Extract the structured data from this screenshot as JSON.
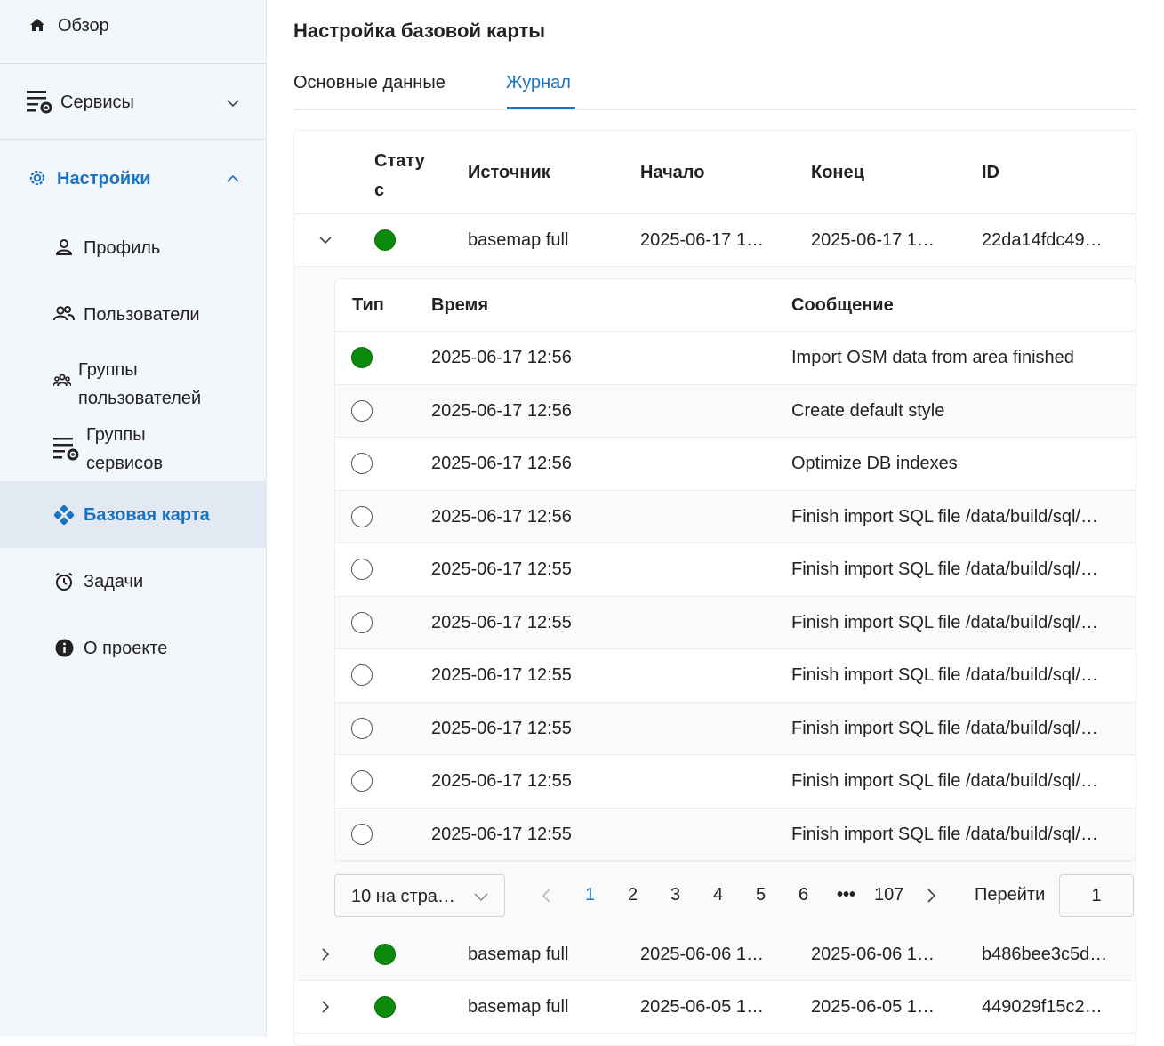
{
  "sidebar": {
    "overview": "Обзор",
    "services": "Сервисы",
    "settings": "Настройки",
    "items": [
      {
        "label": "Профиль"
      },
      {
        "label": "Пользователи"
      },
      {
        "label": "Группы\nпользователей"
      },
      {
        "label": "Группы\nсервисов"
      },
      {
        "label": "Базовая карта"
      },
      {
        "label": "Задачи"
      },
      {
        "label": "О проекте"
      }
    ]
  },
  "page": {
    "title": "Настройка базовой карты",
    "tabs": [
      "Основные данные",
      "Журнал"
    ],
    "active_tab": "Журнал"
  },
  "table": {
    "columns": [
      "Статус",
      "Источник",
      "Начало",
      "Конец",
      "ID"
    ],
    "status_col_line1": "Стату",
    "status_col_line2": "с",
    "rows": [
      {
        "status": "success",
        "source": "basemap full",
        "start": "2025-06-17 1…",
        "end": "2025-06-17 1…",
        "id": "22da14fdc49…",
        "expanded": true
      },
      {
        "status": "success",
        "source": "basemap full",
        "start": "2025-06-06 1…",
        "end": "2025-06-06 1…",
        "id": "b486bee3c5d…",
        "expanded": false
      },
      {
        "status": "success",
        "source": "basemap full",
        "start": "2025-06-05 1…",
        "end": "2025-06-05 1…",
        "id": "449029f15c2…",
        "expanded": false
      }
    ]
  },
  "log": {
    "columns": [
      "Тип",
      "Время",
      "Сообщение"
    ],
    "rows": [
      {
        "type": "success",
        "time": "2025-06-17 12:56",
        "message": "Import OSM data from area finished"
      },
      {
        "type": "info",
        "time": "2025-06-17 12:56",
        "message": "Create default style"
      },
      {
        "type": "info",
        "time": "2025-06-17 12:56",
        "message": "Optimize DB indexes"
      },
      {
        "type": "info",
        "time": "2025-06-17 12:56",
        "message": "Finish import SQL file /data/build/sql/…"
      },
      {
        "type": "info",
        "time": "2025-06-17 12:55",
        "message": "Finish import SQL file /data/build/sql/…"
      },
      {
        "type": "info",
        "time": "2025-06-17 12:55",
        "message": "Finish import SQL file /data/build/sql/…"
      },
      {
        "type": "info",
        "time": "2025-06-17 12:55",
        "message": "Finish import SQL file /data/build/sql/…"
      },
      {
        "type": "info",
        "time": "2025-06-17 12:55",
        "message": "Finish import SQL file /data/build/sql/…"
      },
      {
        "type": "info",
        "time": "2025-06-17 12:55",
        "message": "Finish import SQL file /data/build/sql/…"
      },
      {
        "type": "info",
        "time": "2025-06-17 12:55",
        "message": "Finish import SQL file /data/build/sql/…"
      }
    ]
  },
  "pagination": {
    "page_size": "10 на стра…",
    "pages": [
      "1",
      "2",
      "3",
      "4",
      "5",
      "6",
      "•••",
      "107"
    ],
    "current": "1",
    "goto_label": "Перейти",
    "goto_value": "1"
  },
  "colors": {
    "accent": "#1a73c0",
    "success": "#0c8a0c",
    "sidebar_bg": "#f3f6fa"
  }
}
